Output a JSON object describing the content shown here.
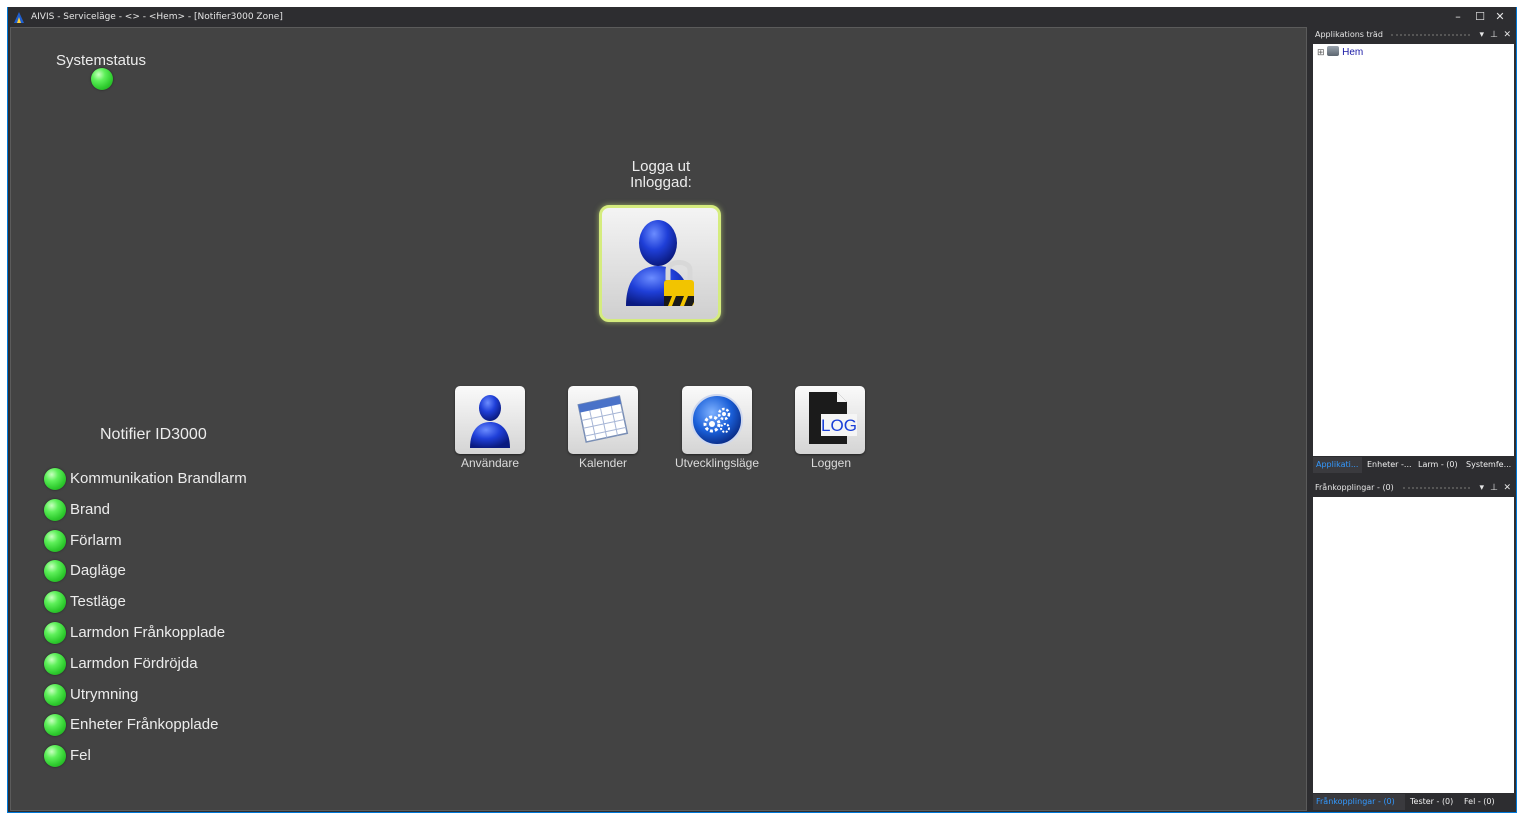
{
  "window": {
    "title": "AIVIS - Serviceläge - <> - <Hem> - [Notifier3000 Zone]",
    "controls": {
      "minimize": "–",
      "maximize": "☐",
      "close": "✕"
    }
  },
  "main": {
    "system_status_label": "Systemstatus",
    "logout_label": "Logga ut",
    "logged_in_label": "Inloggad:",
    "tools": [
      {
        "label": "Användare",
        "icon": "user-icon"
      },
      {
        "label": "Kalender",
        "icon": "calendar-icon"
      },
      {
        "label": "Utvecklingsläge",
        "icon": "gears-icon"
      },
      {
        "label": "Loggen",
        "icon": "log-file-icon",
        "icon_text": "LOG"
      }
    ],
    "panel_title": "Notifier ID3000",
    "statuses": [
      "Kommunikation Brandlarm",
      "Brand",
      "Förlarm",
      "Dagläge",
      "Testläge",
      "Larmdon Frånkopplade",
      "Larmdon Fördröjda",
      "Utrymning",
      "Enheter Frånkopplade",
      "Fel"
    ],
    "status_color": "#3ee03e"
  },
  "dock_top": {
    "title": "Applikations träd",
    "tree": {
      "expander": "⊞",
      "item": "Hem"
    },
    "tabs": [
      "Applikati...",
      "Enheter -...",
      "Larm - (0)",
      "Systemfe..."
    ],
    "active_tab": 0
  },
  "dock_bottom": {
    "title": "Frånkopplingar - (0)",
    "tabs": [
      "Frånkopplingar - (0)",
      "Tester - (0)",
      "Fel - (0)"
    ],
    "active_tab": 0
  },
  "colors": {
    "accent": "#0078d7",
    "window_bg": "#2d2d30",
    "panel_bg": "#434343",
    "active_tab": "#3399ff",
    "login_glow": "#d5ec7e"
  }
}
